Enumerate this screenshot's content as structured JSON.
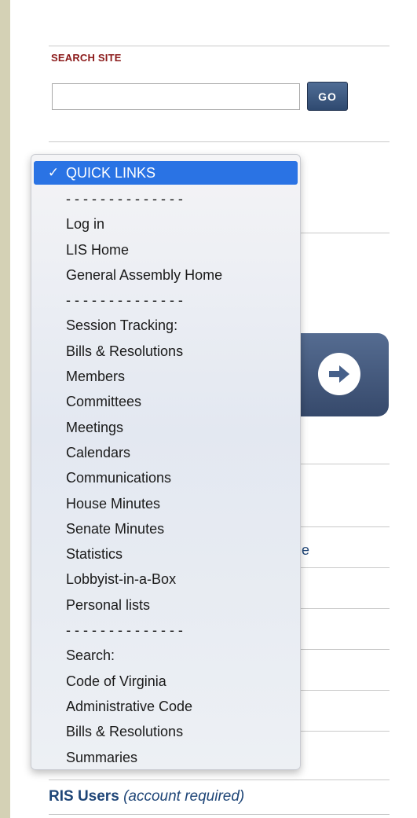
{
  "search": {
    "heading": "SEARCH SITE",
    "value": "",
    "placeholder": "",
    "go_label": "GO"
  },
  "background": {
    "fragment_text": "e"
  },
  "quick_links": {
    "selected": "QUICK LINKS",
    "items": [
      "QUICK LINKS",
      "- - - - - - - - - - - - - -",
      "Log in",
      "LIS Home",
      "General Assembly Home",
      "- - - - - - - - - - - - - -",
      "Session Tracking:",
      "Bills & Resolutions",
      "Members",
      "Committees",
      "Meetings",
      "Calendars",
      "Communications",
      "House Minutes",
      "Senate Minutes",
      "Statistics",
      "Lobbyist-in-a-Box",
      "Personal lists",
      "- - - - - - - - - - - - - -",
      "Search:",
      "Code of Virginia",
      "Administrative Code",
      "Bills & Resolutions",
      "Summaries"
    ]
  },
  "ris": {
    "label": "RIS Users",
    "note": "(account required)"
  },
  "colors": {
    "heading_red": "#8b1a1a",
    "link_blue": "#1e4577",
    "selection_blue": "#2a73e4",
    "go_button": "#3a5680"
  },
  "icons": {
    "selected_marker": "checkmark-icon",
    "panel_button": "right-arrow-icon"
  }
}
